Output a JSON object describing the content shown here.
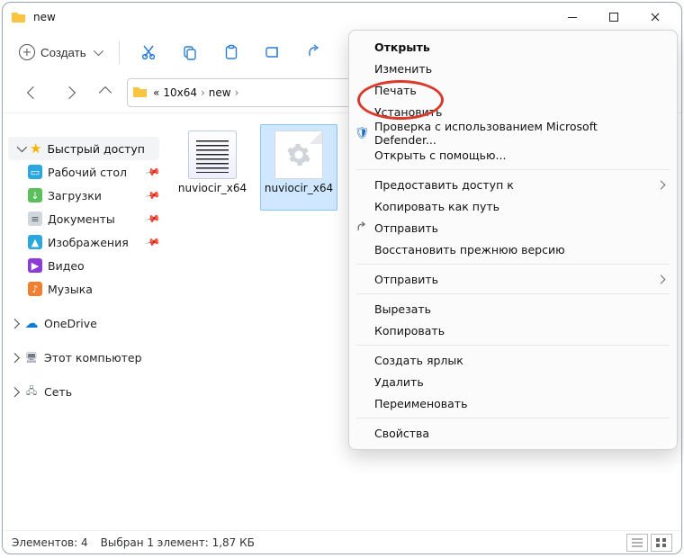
{
  "title": "new",
  "toolbar": {
    "create": "Создать"
  },
  "path": {
    "prefix": "«",
    "seg1": "10x64",
    "seg2": "new"
  },
  "sidebar": {
    "quick": "Быстрый доступ",
    "items": [
      "Рабочий стол",
      "Загрузки",
      "Документы",
      "Изображения",
      "Видео",
      "Музыка"
    ],
    "onedrive": "OneDrive",
    "pc": "Этот компьютер",
    "net": "Сеть"
  },
  "files": [
    "nuviocir_x64",
    "nuviocir_x64"
  ],
  "status": {
    "count_label": "Элементов: 4",
    "sel_label": "Выбран 1 элемент: 1,87 КБ"
  },
  "context_menu": {
    "open": "Открыть",
    "edit": "Изменить",
    "print": "Печать",
    "install": "Установить",
    "defender": "Проверка с использованием Microsoft Defender...",
    "open_with": "Открыть с помощью...",
    "share_access": "Предоставить доступ к",
    "copy_path": "Копировать как путь",
    "send": "Отправить",
    "restore_prev": "Восстановить прежнюю версию",
    "send_to": "Отправить",
    "cut": "Вырезать",
    "copy": "Копировать",
    "shortcut": "Создать ярлык",
    "delete": "Удалить",
    "rename": "Переименовать",
    "properties": "Свойства"
  }
}
